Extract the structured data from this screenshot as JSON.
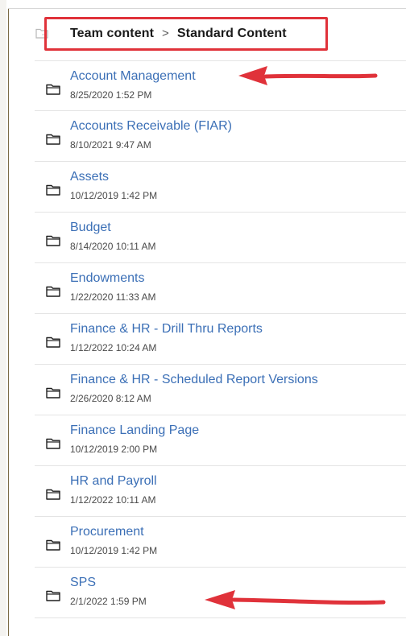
{
  "breadcrumb": {
    "root": "Team content",
    "separator": ">",
    "current": "Standard Content"
  },
  "items": [
    {
      "name": "Account Management",
      "date": "8/25/2020 1:52 PM"
    },
    {
      "name": "Accounts Receivable (FIAR)",
      "date": "8/10/2021 9:47 AM"
    },
    {
      "name": "Assets",
      "date": "10/12/2019 1:42 PM"
    },
    {
      "name": "Budget",
      "date": "8/14/2020 10:11 AM"
    },
    {
      "name": "Endowments",
      "date": "1/22/2020 11:33 AM"
    },
    {
      "name": "Finance & HR - Drill Thru Reports",
      "date": "1/12/2022 10:24 AM"
    },
    {
      "name": "Finance & HR - Scheduled Report Versions",
      "date": "2/26/2020 8:12 AM"
    },
    {
      "name": "Finance Landing Page",
      "date": "10/12/2019 2:00 PM"
    },
    {
      "name": "HR and Payroll",
      "date": "1/12/2022 10:11 AM"
    },
    {
      "name": "Procurement",
      "date": "10/12/2019 1:42 PM"
    },
    {
      "name": "SPS",
      "date": "2/1/2022 1:59 PM"
    }
  ],
  "colors": {
    "link": "#3b6fb6",
    "annotation": "#e0323a",
    "date_text": "#4a4a4a"
  },
  "icons": {
    "breadcrumb": "folder-outline-icon",
    "row": "folder-icon"
  }
}
